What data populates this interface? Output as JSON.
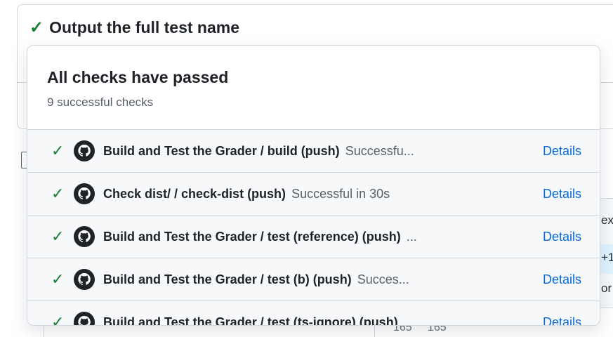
{
  "background": {
    "job_title": "Output the full test name",
    "right_fragments": [
      "ex",
      "+1",
      "or"
    ],
    "bottom_numbers": "165     165"
  },
  "popover": {
    "title": "All checks have passed",
    "subtitle": "9 successful checks",
    "checks": [
      {
        "name": "Build and Test the Grader / build (push)",
        "status": "Successfu...",
        "details": "Details"
      },
      {
        "name": "Check dist/ / check-dist (push)",
        "status": "Successful in 30s",
        "details": "Details"
      },
      {
        "name": "Build and Test the Grader / test (reference) (push)",
        "status": "...",
        "details": "Details"
      },
      {
        "name": "Build and Test the Grader / test (b) (push)",
        "status": "Succes...",
        "details": "Details"
      },
      {
        "name": "Build and Test the Grader / test (ts-ignore) (push)",
        "status": "",
        "details": "Details"
      }
    ]
  },
  "colors": {
    "success": "#1a7f37",
    "link": "#0969da",
    "muted": "#57606a"
  },
  "icons": {
    "check": "check-icon",
    "github": "github-icon"
  }
}
